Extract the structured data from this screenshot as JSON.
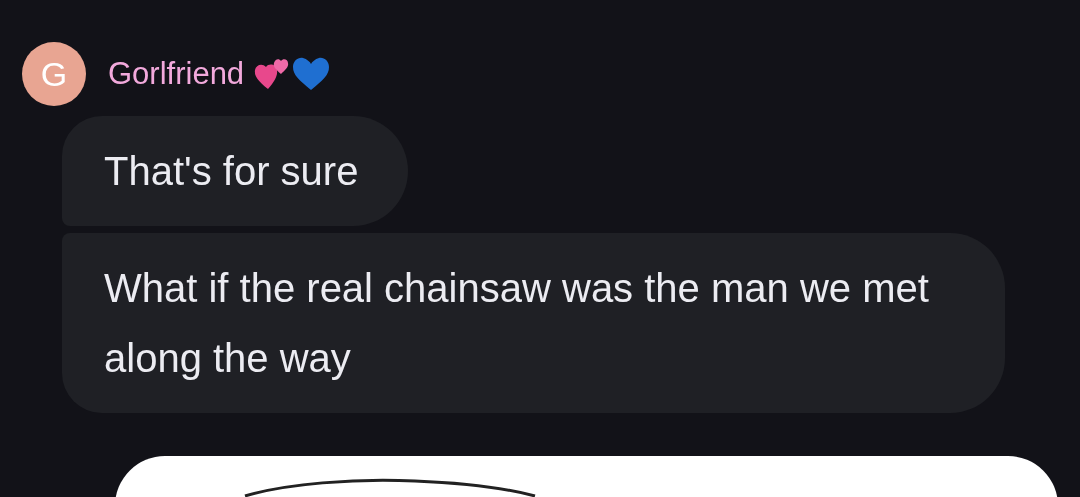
{
  "sender": {
    "initial": "G",
    "name": "Gorlfriend"
  },
  "messages": [
    {
      "text": "That's for sure"
    },
    {
      "text": "What if the real chainsaw was the man we met along the way"
    }
  ]
}
